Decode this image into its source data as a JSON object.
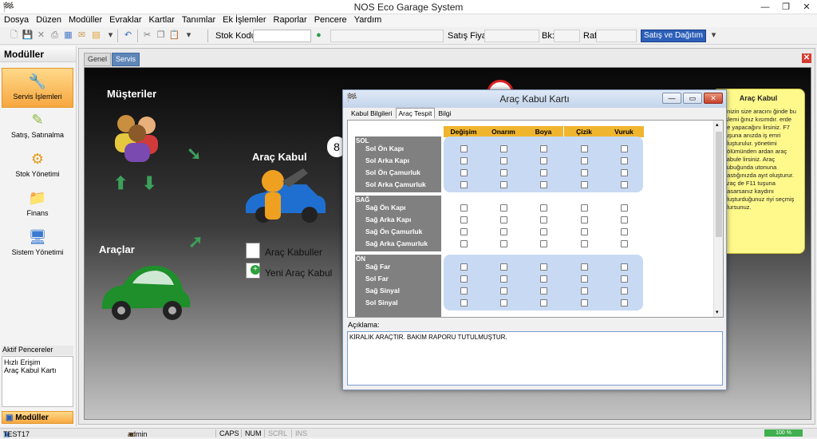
{
  "app": {
    "title": "NOS Eco Garage System"
  },
  "menu": [
    "Dosya",
    "Düzen",
    "Modüller",
    "Evraklar",
    "Kartlar",
    "Tanımlar",
    "Ek İşlemler",
    "Raporlar",
    "Pencere",
    "Yardım"
  ],
  "toolbar": {
    "stok_label": "Stok Kodu",
    "satis_label": "Satış Fiyatı",
    "bk_label": "Bk:",
    "raf_label": "Raf",
    "button_label": "Satış ve Dağıtım"
  },
  "sidebar": {
    "title": "Modüller",
    "items": [
      {
        "label": "Servis İşlemleri",
        "icon": "wrench-icon"
      },
      {
        "label": "Satış, Satınalma",
        "icon": "pen-icon"
      },
      {
        "label": "Stok Yönetimi",
        "icon": "gear-icon"
      },
      {
        "label": "Finans",
        "icon": "folder-icon"
      },
      {
        "label": "Sistem Yönetimi",
        "icon": "computer-icon"
      }
    ],
    "panel_title": "Aktif Pencereler",
    "panel_items": [
      "Hızlı Erişim",
      "Araç Kabul Kartı"
    ],
    "footer": "Modüller"
  },
  "content": {
    "tabs": [
      "Genel",
      "Servis"
    ],
    "musteriler": "Müşteriler",
    "arac_kabul": "Araç Kabul",
    "araclar": "Araçlar",
    "link1": "Araç Kabuller",
    "link2": "Yeni Araç Kabul"
  },
  "infobox": {
    "title": "Araç Kabul",
    "text": "rinizin size aracını ğinde bu işlemi ğınız kısımdır. erde ne yapacağını lirsiniz. F7 tuşuna anızda iş emri oluşturulur. yönetimi bölümünden ardan araç kabule lirsiniz. Araç çubuğunda utonuna bastığınızda ayıt oluşturur. Araç de F11 tuşuna basarsanız kaydını oluşturduğunuz riyi seçmiş olursunuz."
  },
  "dialog": {
    "title": "Araç Kabul Kartı",
    "tabs": [
      "Kabul Bilgileri",
      "Araç Tespit",
      "Bilgi"
    ],
    "columns": [
      "Değişim",
      "Onarım",
      "Boya",
      "Çizik",
      "Vuruk"
    ],
    "sections": [
      {
        "name": "SOL",
        "rows": [
          "Sol Ön Kapı",
          "Sol Arka Kapı",
          "Sol Ön Çamurluk",
          "Sol Arka Çamurluk"
        ]
      },
      {
        "name": "SAĞ",
        "rows": [
          "Sağ Ön Kapı",
          "Sağ Arka Kapı",
          "Sağ Ön Çamurluk",
          "Sağ Arka Çamurluk"
        ]
      },
      {
        "name": "ÖN",
        "rows": [
          "Sağ Far",
          "Sol Far",
          "Sağ Sinyal",
          "Sol Sinyal"
        ]
      }
    ],
    "aciklama_label": "Açıklama:",
    "aciklama_value": "KİRALIK ARAÇTIR. BAKIM RAPORU TUTULMUŞTUR."
  },
  "status": {
    "user_code": "TEST17",
    "user": "admin",
    "caps": "CAPS",
    "num": "NUM",
    "scrl": "SCRL",
    "ins": "INS",
    "zoom": "100 %"
  }
}
